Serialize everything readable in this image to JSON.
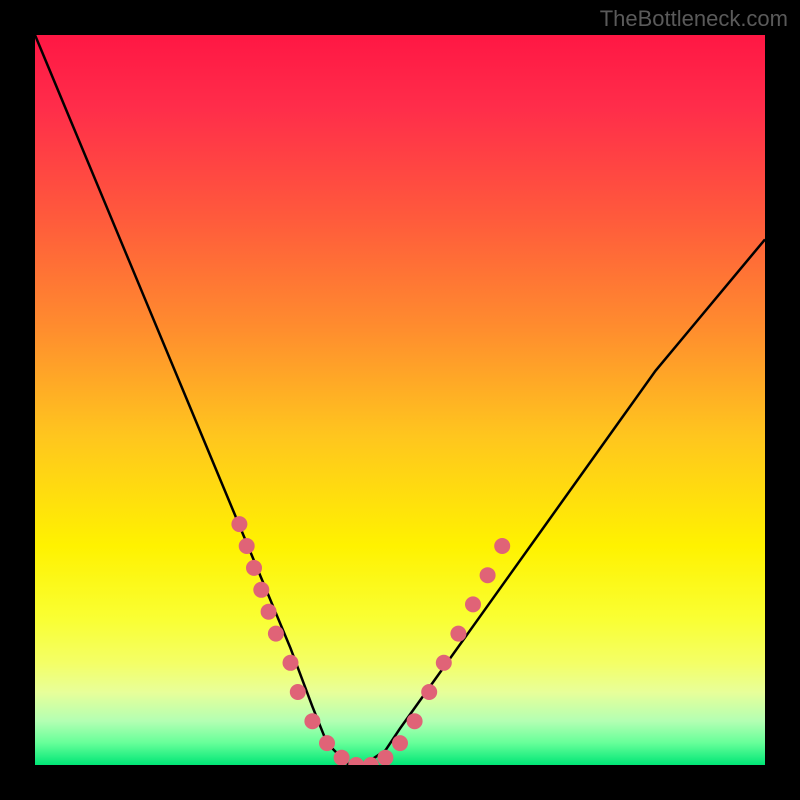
{
  "watermark": "TheBottleneck.com",
  "chart_data": {
    "type": "line",
    "title": "",
    "xlabel": "",
    "ylabel": "",
    "xlim": [
      0,
      100
    ],
    "ylim": [
      0,
      100
    ],
    "curve": {
      "name": "bottleneck-curve",
      "description": "V-shaped bottleneck curve with minimum near x≈43",
      "x": [
        0,
        5,
        10,
        15,
        20,
        25,
        30,
        35,
        38,
        40,
        42,
        43,
        45,
        48,
        50,
        55,
        60,
        65,
        70,
        75,
        80,
        85,
        90,
        95,
        100
      ],
      "y": [
        100,
        88,
        76,
        64,
        52,
        40,
        28,
        16,
        8,
        3,
        1,
        0,
        0,
        2,
        5,
        12,
        19,
        26,
        33,
        40,
        47,
        54,
        60,
        66,
        72
      ]
    },
    "markers": {
      "name": "data-points",
      "color": "#e06377",
      "radius": 8,
      "points": [
        {
          "x": 28,
          "y": 33
        },
        {
          "x": 29,
          "y": 30
        },
        {
          "x": 30,
          "y": 27
        },
        {
          "x": 31,
          "y": 24
        },
        {
          "x": 32,
          "y": 21
        },
        {
          "x": 33,
          "y": 18
        },
        {
          "x": 35,
          "y": 14
        },
        {
          "x": 36,
          "y": 10
        },
        {
          "x": 38,
          "y": 6
        },
        {
          "x": 40,
          "y": 3
        },
        {
          "x": 42,
          "y": 1
        },
        {
          "x": 44,
          "y": 0
        },
        {
          "x": 46,
          "y": 0
        },
        {
          "x": 48,
          "y": 1
        },
        {
          "x": 50,
          "y": 3
        },
        {
          "x": 52,
          "y": 6
        },
        {
          "x": 54,
          "y": 10
        },
        {
          "x": 56,
          "y": 14
        },
        {
          "x": 58,
          "y": 18
        },
        {
          "x": 60,
          "y": 22
        },
        {
          "x": 62,
          "y": 26
        },
        {
          "x": 64,
          "y": 30
        }
      ]
    },
    "gradient_stops": [
      {
        "offset": 0,
        "color": "#ff1744"
      },
      {
        "offset": 10,
        "color": "#ff2d4a"
      },
      {
        "offset": 25,
        "color": "#ff5a3c"
      },
      {
        "offset": 40,
        "color": "#ff8c2e"
      },
      {
        "offset": 55,
        "color": "#ffc61e"
      },
      {
        "offset": 70,
        "color": "#fff200"
      },
      {
        "offset": 80,
        "color": "#f9ff33"
      },
      {
        "offset": 86,
        "color": "#f4ff66"
      },
      {
        "offset": 90,
        "color": "#e8ff99"
      },
      {
        "offset": 94,
        "color": "#b3ffb3"
      },
      {
        "offset": 97,
        "color": "#66ff99"
      },
      {
        "offset": 100,
        "color": "#00e676"
      }
    ]
  }
}
